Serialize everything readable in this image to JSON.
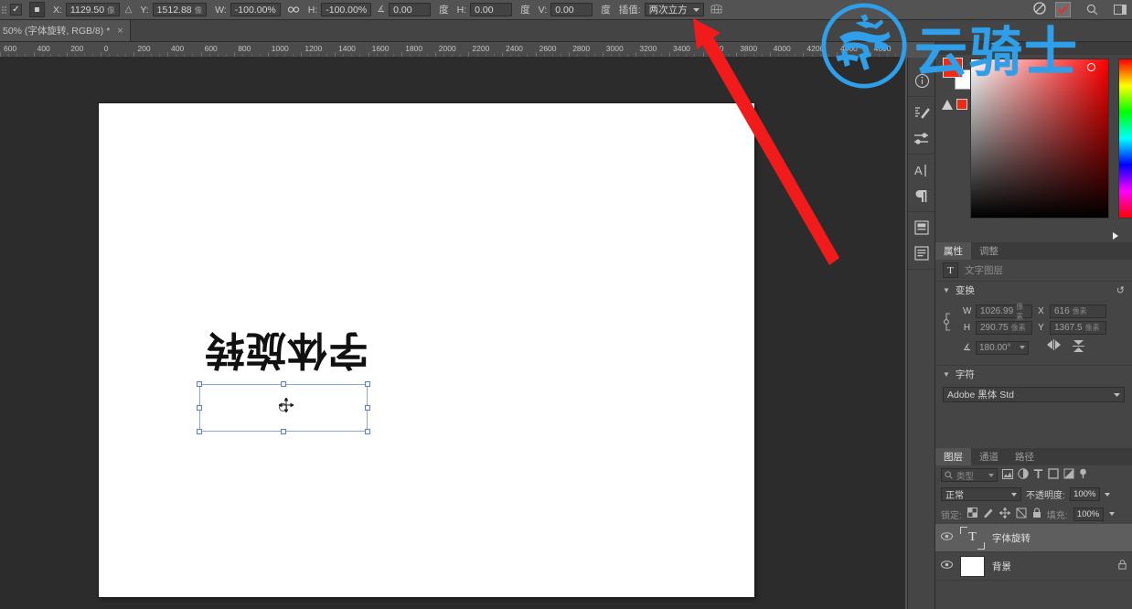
{
  "options_bar": {
    "commit_checkbox": "✓",
    "reference_point_name": "reference-point-grid",
    "x_label": "X:",
    "x_value": "1129.50",
    "x_unit": "像",
    "delta_symbol": "△",
    "y_label": "Y:",
    "y_value": "1512.88",
    "y_unit": "像",
    "w_label": "W:",
    "w_value": "-100.00%",
    "link_icon": "∞",
    "h_label": "H:",
    "h_value": "-100.00%",
    "angle_symbol": "∡",
    "angle_value": "0.00",
    "deg_unit_1": "度",
    "skew_h_label": "H:",
    "skew_h_value": "0.00",
    "deg_unit_2": "度",
    "skew_v_label": "V:",
    "skew_v_value": "0.00",
    "deg_unit_3": "度",
    "interp_label": "插值:",
    "interp_value": "两次立方",
    "warp_icon": "warp-icon",
    "cancel_label": "⊘",
    "commit_label": "✓",
    "search_icon": "search-icon",
    "workspace_icon": "workspace-icon"
  },
  "tab": {
    "title": "50% (字体旋转, RGB/8) *",
    "close": "×"
  },
  "ruler": {
    "ticks": [
      "600",
      "400",
      "200",
      "0",
      "200",
      "400",
      "600",
      "800",
      "1000",
      "1200",
      "1400",
      "1600",
      "1800",
      "2000",
      "2200",
      "2400",
      "2600",
      "2800",
      "3000",
      "3200",
      "3400",
      "3600",
      "3800",
      "4000",
      "4200",
      "4400",
      "4600"
    ]
  },
  "canvas": {
    "layer_text": "字体旋转",
    "rotation": "180",
    "cursor": "move-cursor"
  },
  "rail": {
    "items": [
      {
        "name": "info-icon",
        "glyph": "ⓘ"
      },
      {
        "name": "brush-presets-icon",
        "glyph": "🖌"
      },
      {
        "name": "adjustments-icon",
        "glyph": "⇄"
      },
      {
        "name": "character-icon",
        "glyph": "A|"
      },
      {
        "name": "paragraph-icon",
        "glyph": "¶"
      },
      {
        "name": "libraries-icon",
        "glyph": "▣"
      },
      {
        "name": "notes-icon",
        "glyph": "▤"
      }
    ]
  },
  "color_panel": {
    "foreground": "#f02a15",
    "background": "#ffffff",
    "out_of_gamut_label": "out-of-gamut-warning"
  },
  "properties": {
    "tabs": [
      {
        "label": "属性",
        "active": true
      },
      {
        "label": "调整",
        "active": false
      }
    ],
    "layer_type": "文字图层",
    "transform": {
      "title": "变换",
      "reset": "↺",
      "w_label": "W",
      "w_value": "1026.99",
      "w_unit": "像素",
      "x_label": "X",
      "x_value": "616",
      "x_unit": "像素",
      "h_label": "H",
      "h_value": "290.75",
      "h_unit": "像素",
      "y_label": "Y",
      "y_value": "1367.5",
      "y_unit": "像素",
      "angle_symbol": "∡",
      "angle_value": "180.00°",
      "flip_h": "flip-horizontal-icon",
      "flip_v": "flip-vertical-icon"
    },
    "character": {
      "title": "字符",
      "font": "Adobe 黑体 Std"
    }
  },
  "layers_panel": {
    "tabs": [
      {
        "label": "图层",
        "active": true
      },
      {
        "label": "通道",
        "active": false
      },
      {
        "label": "路径",
        "active": false
      }
    ],
    "filter_placeholder": "类型",
    "filter_icons": [
      "pixel-filter-icon",
      "adjustment-filter-icon",
      "type-filter-icon",
      "shape-filter-icon",
      "smartobject-filter-icon",
      "filter-toggle-icon"
    ],
    "blend_mode": "正常",
    "opacity_label": "不透明度:",
    "opacity_value": "100%",
    "lock_label": "锁定:",
    "lock_icons": [
      "lock-transparency-icon",
      "lock-image-icon",
      "lock-position-icon",
      "lock-artboard-icon",
      "lock-all-icon"
    ],
    "fill_label": "填充:",
    "fill_value": "100%",
    "layers": [
      {
        "name": "字体旋转",
        "type": "text",
        "visible": "👁",
        "selected": true,
        "locked": false
      },
      {
        "name": "背景",
        "type": "background",
        "visible": "👁",
        "selected": false,
        "locked": true,
        "lock_glyph": "🔒"
      }
    ]
  },
  "watermark": {
    "text": "云骑士",
    "color": "#2e9fe8"
  },
  "annotation": {
    "arrow_color": "#f11b1b",
    "arrow_name": "red-pointer-arrow"
  }
}
